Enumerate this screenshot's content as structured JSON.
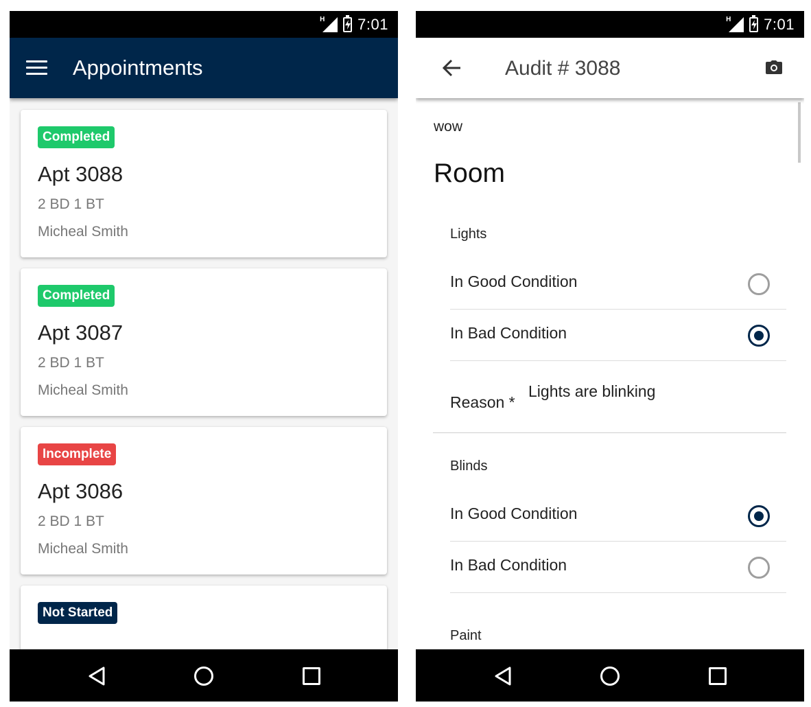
{
  "status_bar": {
    "network": "H",
    "time": "7:01"
  },
  "appointments_screen": {
    "title": "Appointments",
    "cards": [
      {
        "status": "Completed",
        "status_color": "#1ec96b",
        "title": "Apt 3088",
        "layout": "2 BD 1 BT",
        "person": "Micheal Smith"
      },
      {
        "status": "Completed",
        "status_color": "#1ec96b",
        "title": "Apt 3087",
        "layout": "2 BD 1 BT",
        "person": "Micheal Smith"
      },
      {
        "status": "Incomplete",
        "status_color": "#e84545",
        "title": "Apt 3086",
        "layout": "2 BD 1 BT",
        "person": "Micheal Smith"
      },
      {
        "status": "Not Started",
        "status_color": "#00264a"
      }
    ]
  },
  "audit_screen": {
    "title": "Audit # 3088",
    "subtitle": "wow",
    "section": "Room",
    "items": [
      {
        "label": "Lights",
        "options": [
          {
            "label": "In Good Condition",
            "selected": false
          },
          {
            "label": "In Bad Condition",
            "selected": true
          }
        ],
        "reason_label": "Reason *",
        "reason_value": "Lights are blinking"
      },
      {
        "label": "Blinds",
        "options": [
          {
            "label": "In Good Condition",
            "selected": true
          },
          {
            "label": "In Bad Condition",
            "selected": false
          }
        ]
      },
      {
        "label": "Paint"
      }
    ]
  },
  "colors": {
    "primary": "#00264a",
    "completed": "#1ec96b",
    "incomplete": "#e84545"
  },
  "icons": [
    "menu-icon",
    "back-arrow-icon",
    "camera-icon",
    "nav-back-icon",
    "nav-home-icon",
    "nav-recents-icon",
    "signal-icon",
    "battery-icon"
  ]
}
